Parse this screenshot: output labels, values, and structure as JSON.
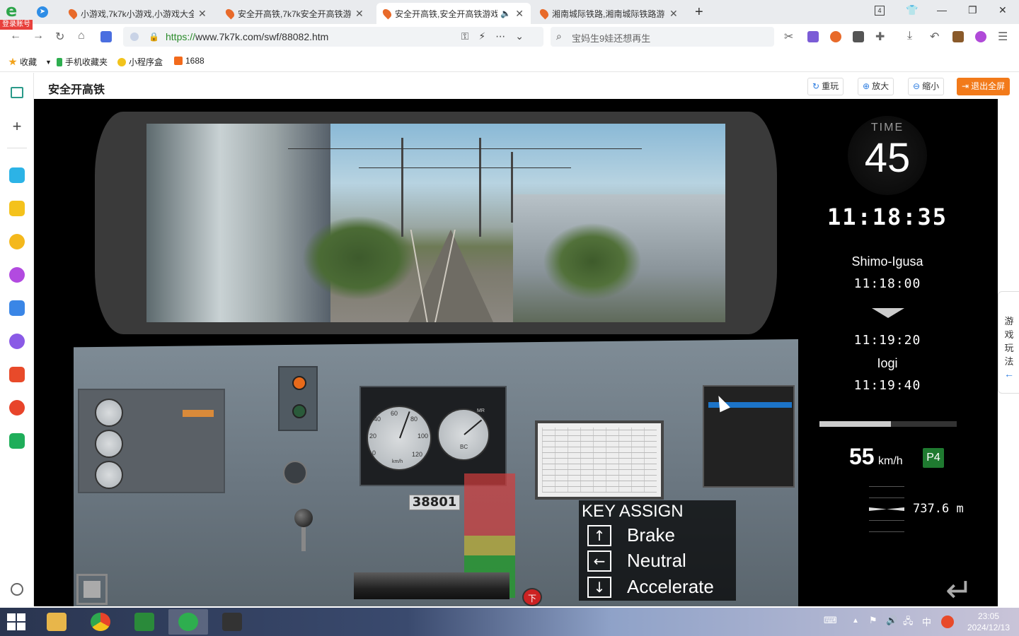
{
  "browser": {
    "login_badge": "登录账号",
    "tabs": [
      {
        "title": "小游戏,7k7k小游戏,小游戏大全",
        "active": false
      },
      {
        "title": "安全开高铁,7k7k安全开高铁游",
        "active": false
      },
      {
        "title": "安全开高铁,安全开高铁游戏",
        "active": true
      },
      {
        "title": "湘南城际铁路,湘南城际铁路游",
        "active": false
      }
    ],
    "url_scheme": "https://",
    "url_rest": "www.7k7k.com/swf/88082.htm",
    "search_text": "宝妈生9娃还想再生"
  },
  "bookmarks": [
    {
      "label": "收藏",
      "color": "#f2a31c"
    },
    {
      "label": "手机收藏夹",
      "color": "#2eae4f"
    },
    {
      "label": "小程序盒",
      "color": "#f2c31c"
    },
    {
      "label": "1688",
      "color": "#f26a1c"
    }
  ],
  "game_header": {
    "title": "安全开高铁",
    "buttons": {
      "replay": "重玩",
      "zoom_in": "放大",
      "zoom_out": "缩小",
      "exit_fullscreen": "退出全屏"
    }
  },
  "side_help": "游戏玩法",
  "game": {
    "time_label": "TIME",
    "time_remaining": "45",
    "clock": "11:18:35",
    "stations": [
      {
        "name": "Shimo-Igusa",
        "time": "11:18:00"
      },
      {
        "name": "",
        "time": "11:19:20"
      },
      {
        "name": "Iogi",
        "time": "11:19:40"
      }
    ],
    "progress": 0.52,
    "speed": "55",
    "speed_unit": "km/h",
    "notch": "P4",
    "distance": "737.6",
    "distance_unit": "m",
    "train_number": "38801",
    "stop_button": "下",
    "key_assign": {
      "title": "KEY ASSIGN",
      "keys": [
        {
          "key": "↑",
          "action": "Brake"
        },
        {
          "key": "←",
          "action": "Neutral"
        },
        {
          "key": "↓",
          "action": "Accelerate"
        }
      ]
    },
    "gauges": {
      "speed_ticks": [
        "20",
        "40",
        "60",
        "80",
        "100",
        "120",
        "0"
      ],
      "speed_unit": "km/h",
      "brake_unit": "BC",
      "brake_mr": "MR"
    }
  },
  "taskbar": {
    "time": "23:05",
    "date": "2024/12/13",
    "ime": "中"
  }
}
